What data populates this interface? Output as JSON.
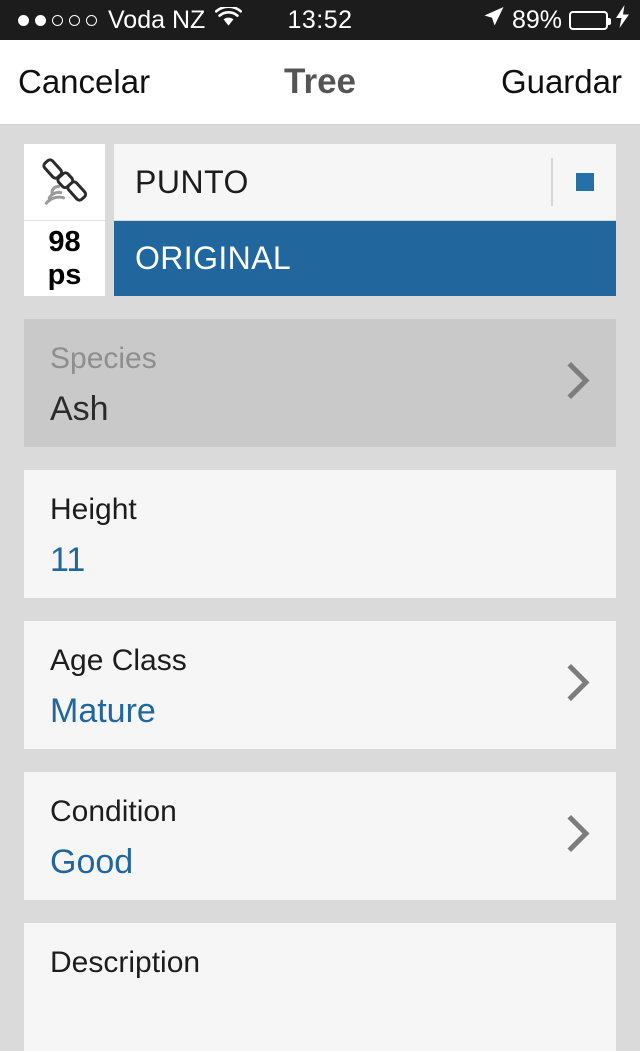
{
  "status_bar": {
    "signal_dots_total": 5,
    "signal_dots_filled": 2,
    "carrier": "Voda NZ",
    "wifi_icon": "wifi-icon",
    "time": "13:52",
    "location_icon": "location-arrow-icon",
    "battery_percent": "89%",
    "battery_level": 100,
    "battery_color": "#4cd453",
    "charging_icon": "lightning-bolt-icon"
  },
  "nav_bar": {
    "cancel_label": "Cancelar",
    "title": "Tree",
    "save_label": "Guardar"
  },
  "header": {
    "satellite_icon": "satellite-icon",
    "accuracy_value": "98",
    "accuracy_unit": "ps",
    "point_label": "PUNTO",
    "point_swatch_color": "#2470a8",
    "layer_label": "ORIGINAL",
    "layer_bg_color": "#21679e"
  },
  "fields": [
    {
      "label": "Species",
      "value": "Ash",
      "has_chevron": true,
      "highlighted": true,
      "value_style": "dark"
    },
    {
      "label": "Height",
      "value": "11",
      "has_chevron": false,
      "highlighted": false,
      "value_style": "blue"
    },
    {
      "label": "Age Class",
      "value": "Mature",
      "has_chevron": true,
      "highlighted": false,
      "value_style": "blue"
    },
    {
      "label": "Condition",
      "value": "Good",
      "has_chevron": true,
      "highlighted": false,
      "value_style": "blue"
    },
    {
      "label": "Description",
      "value": "",
      "has_chevron": false,
      "highlighted": false,
      "value_style": "blue",
      "partial": true
    }
  ],
  "colors": {
    "accent_blue": "#21679e",
    "page_background": "#dadada",
    "card_background": "#f6f6f6",
    "highlight_background": "#c9c9c9",
    "chevron_gray": "#808080"
  }
}
